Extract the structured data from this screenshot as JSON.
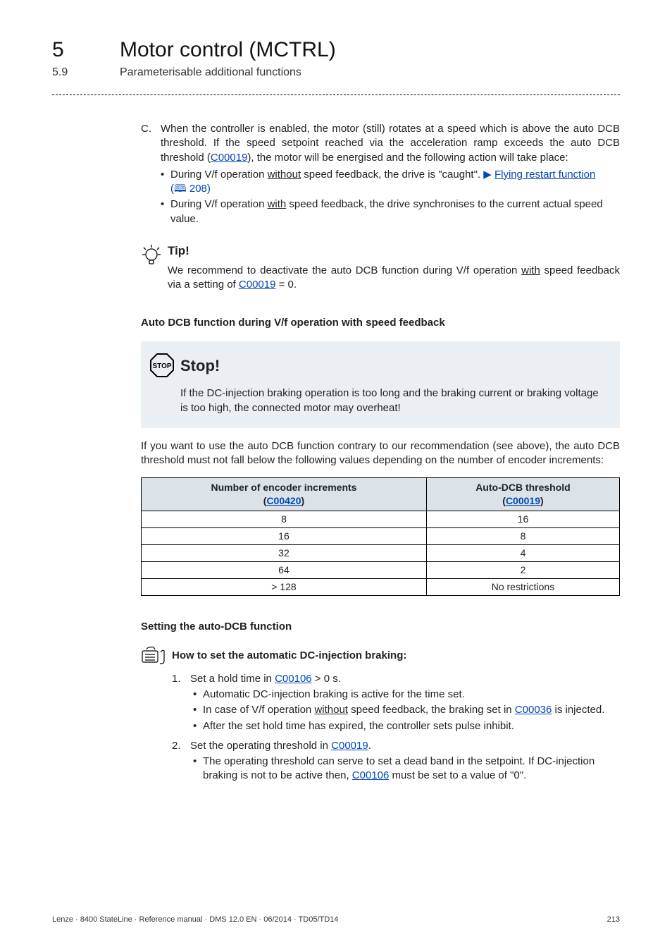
{
  "header": {
    "chapter_num": "5",
    "chapter_title": "Motor control (MCTRL)",
    "section_num": "5.9",
    "section_title": "Parameterisable additional functions"
  },
  "listC": {
    "marker": "C.",
    "text_1": "When the controller is enabled, the motor (still) rotates at a speed which is above the auto DCB threshold. If the speed setpoint reached via the acceleration ramp exceeds the auto DCB threshold (",
    "link_1": "C00019",
    "text_2": "), the motor will be energised and the following action will take place:",
    "sub1_a": "During V/f operation ",
    "sub1_u": "without",
    "sub1_b": " speed feedback, the drive is \"caught\". ",
    "sub1_arrow": "▶ ",
    "sub1_link": "Flying restart function",
    "sub1_ref": "(🕮 208)",
    "sub2_a": "During V/f operation ",
    "sub2_u": "with",
    "sub2_b": " speed feedback, the drive synchronises to the current actual speed value."
  },
  "tip": {
    "label": "Tip!",
    "text_a": "We recommend to deactivate the auto DCB function during V/f operation ",
    "text_u": "with",
    "text_b": " speed feedback via a setting of ",
    "link": "C00019",
    "text_c": " = 0."
  },
  "h3_a": "Auto DCB function during V/f operation with speed feedback",
  "stop": {
    "label": "Stop!",
    "text": "If the DC-injection braking operation is too long and the braking current or braking voltage is too high, the connected motor may overheat!"
  },
  "para1": "If you want to use the auto DCB function contrary to our recommendation (see above), the auto DCB threshold must not fall below the following values depending on the number of encoder increments:",
  "table": {
    "h1a": "Number of encoder increments",
    "h1b": "C00420",
    "h2a": "Auto-DCB threshold",
    "h2b": "C00019",
    "rows": [
      [
        "8",
        "16"
      ],
      [
        "16",
        "8"
      ],
      [
        "32",
        "4"
      ],
      [
        "64",
        "2"
      ],
      [
        "> 128",
        "No restrictions"
      ]
    ]
  },
  "h3_b": "Setting the auto-DCB function",
  "howto": {
    "label": "How to set the automatic DC-injection braking:"
  },
  "steps": {
    "s1_a": "Set a hold time in ",
    "s1_link": "C00106",
    "s1_b": " > 0 s.",
    "s1_sub1": "Automatic DC-injection braking is active for the time set.",
    "s1_sub2_a": "In case of V/f operation ",
    "s1_sub2_u": "without",
    "s1_sub2_b": " speed feedback, the braking set in ",
    "s1_sub2_link": "C00036",
    "s1_sub2_c": " is injected.",
    "s1_sub3": "After the set hold time has expired, the controller sets pulse inhibit.",
    "s2_a": "Set the operating threshold in ",
    "s2_link": "C00019",
    "s2_b": ".",
    "s2_sub1_a": "The operating threshold can serve to set a dead band in the setpoint. If DC-injection braking is not to be active then, ",
    "s2_sub1_link": "C00106",
    "s2_sub1_b": " must be set to a value of \"0\"."
  },
  "footer": {
    "left": "Lenze · 8400 StateLine · Reference manual · DMS 12.0 EN · 06/2014 · TD05/TD14",
    "right": "213"
  }
}
